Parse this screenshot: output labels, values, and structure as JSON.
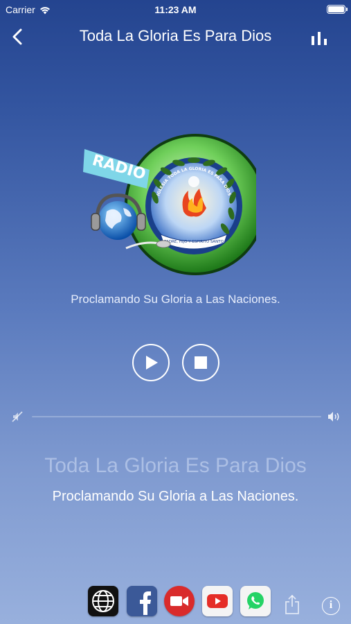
{
  "status_bar": {
    "carrier": "Carrier",
    "time": "11:23 AM",
    "battery_level": 1.0
  },
  "nav": {
    "title": "Toda La Gloria Es Para Dios",
    "back_icon": "chevron-left-icon",
    "right_icon": "bar-chart-icon"
  },
  "logo": {
    "banner_text": "RADIO",
    "ring_text": "IGLESIA TODA LA GLORIA ES PARA DIOS",
    "motto_text": "PADRE, HIJO Y ESPIRITU SANTO"
  },
  "tagline": "Proclamando Su Gloria a Las Naciones.",
  "controls": {
    "play_icon": "play-icon",
    "stop_icon": "stop-icon"
  },
  "volume": {
    "level": 0.0,
    "min_icon": "volume-mute-icon",
    "max_icon": "volume-max-icon"
  },
  "now_playing": {
    "station": "Toda La Gloria Es Para Dios",
    "slogan": "Proclamando Su Gloria a Las Naciones."
  },
  "bottom_bar": {
    "social": [
      {
        "icon": "website-globe-icon"
      },
      {
        "icon": "facebook-icon"
      },
      {
        "icon": "video-camera-icon"
      },
      {
        "icon": "youtube-icon"
      },
      {
        "icon": "whatsapp-icon"
      }
    ],
    "share_icon": "share-icon",
    "info_icon": "info-icon",
    "info_glyph": "i"
  },
  "colors": {
    "background_top": "#24448f",
    "background_bottom": "#98b0dd",
    "facebook": "#3b5998",
    "video": "#d92b2b",
    "youtube": "#e52d27",
    "whatsapp": "#25d366"
  }
}
